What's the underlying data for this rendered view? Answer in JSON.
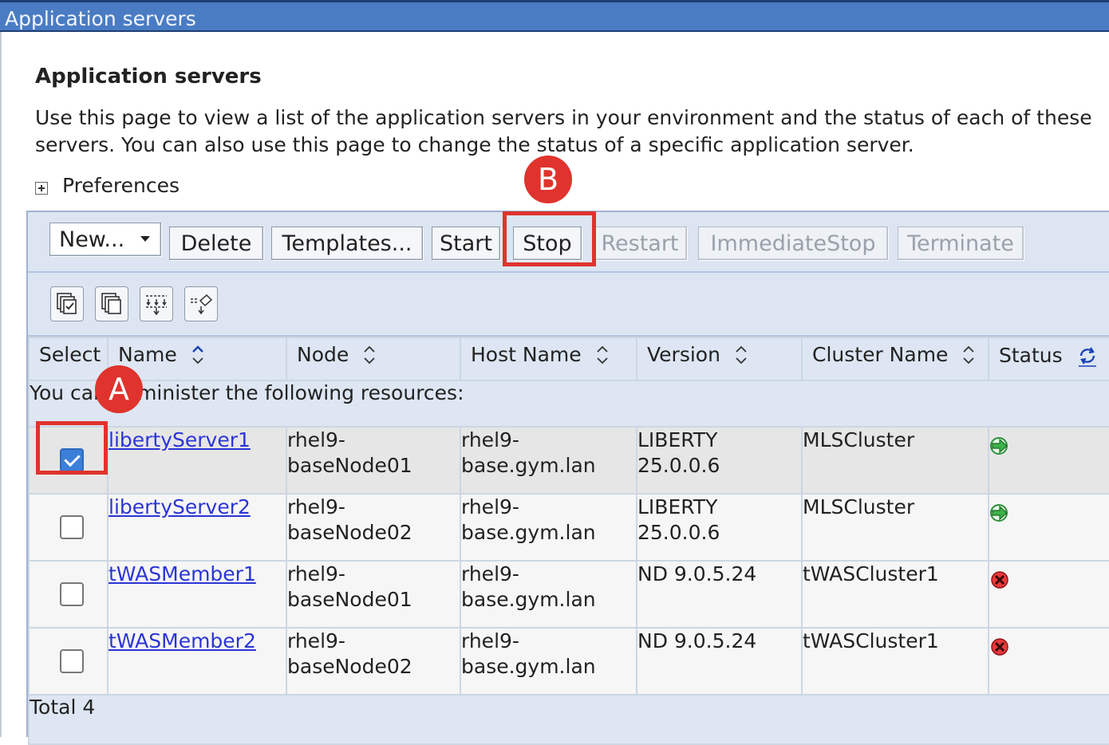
{
  "window": {
    "title": "Application servers"
  },
  "page": {
    "heading": "Application servers",
    "description": "Use this page to view a list of the application servers in your environment and the status of each of these servers. You can also use this page to change the status of a specific application server.",
    "preferences_label": "Preferences"
  },
  "toolbar": {
    "new_label": "New...",
    "delete_label": "Delete",
    "templates_label": "Templates...",
    "start_label": "Start",
    "stop_label": "Stop",
    "restart_label": "Restart",
    "immediatestop_label": "ImmediateStop",
    "terminate_label": "Terminate"
  },
  "iconbar": [
    "select-all-icon",
    "deselect-all-icon",
    "show-filter-icon",
    "clear-filter-icon"
  ],
  "table": {
    "columns": [
      "Select",
      "Name",
      "Node",
      "Host Name",
      "Version",
      "Cluster Name",
      "Status"
    ],
    "admin_message": "You can administer the following resources:",
    "rows": [
      {
        "selected": true,
        "name": "libertyServer1",
        "node": "rhel9-baseNode01",
        "host": "rhel9-base.gym.lan",
        "version": "LIBERTY 25.0.0.6",
        "cluster": "MLSCluster",
        "status": "started"
      },
      {
        "selected": false,
        "name": "libertyServer2",
        "node": "rhel9-baseNode02",
        "host": "rhel9-base.gym.lan",
        "version": "LIBERTY 25.0.0.6",
        "cluster": "MLSCluster",
        "status": "started"
      },
      {
        "selected": false,
        "name": "tWASMember1",
        "node": "rhel9-baseNode01",
        "host": "rhel9-base.gym.lan",
        "version": "ND 9.0.5.24",
        "cluster": "tWASCluster1",
        "status": "stopped"
      },
      {
        "selected": false,
        "name": "tWASMember2",
        "node": "rhel9-baseNode02",
        "host": "rhel9-base.gym.lan",
        "version": "ND 9.0.5.24",
        "cluster": "tWASCluster1",
        "status": "stopped"
      }
    ],
    "total_label": "Total 4"
  },
  "annotations": {
    "marker_a": "A",
    "marker_b": "B"
  },
  "colors": {
    "titlebar": "#4a7cc4",
    "annotation": "#e0332d",
    "link": "#2b35d6",
    "checked": "#3b7fd9"
  }
}
